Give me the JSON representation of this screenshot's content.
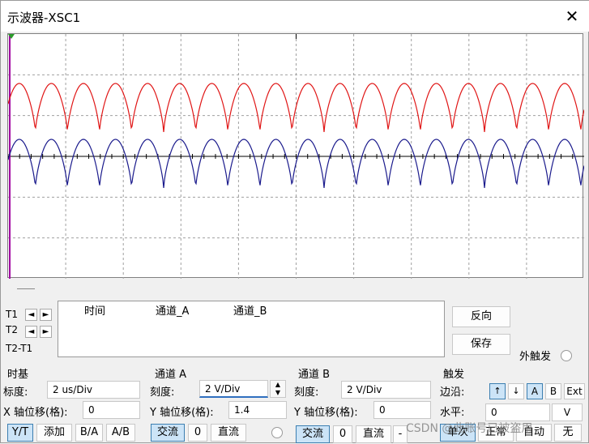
{
  "window": {
    "title": "示波器-XSC1",
    "close_glyph": "✕"
  },
  "colors": {
    "channel_a": "#e01515",
    "channel_b": "#1a1a8c",
    "trigger_marker": "#a000a0",
    "grid": "#a0a0a0"
  },
  "cursors": {
    "t1": "T1",
    "t2": "T2",
    "t2_t1": "T2-T1",
    "left_glyph": "◄",
    "right_glyph": "►"
  },
  "readout": {
    "headers": [
      "时间",
      "通道_A",
      "通道_B"
    ]
  },
  "buttons": {
    "reverse": "反向",
    "save": "保存"
  },
  "ext_trigger": {
    "label": "外触发"
  },
  "timebase": {
    "title": "时基",
    "scale_label": "标度:",
    "scale_value": "2 us/Div",
    "xpos_label": "X 轴位移(格):",
    "xpos_value": "0",
    "modes": [
      "Y/T",
      "添加",
      "B/A",
      "A/B"
    ],
    "active_mode": "Y/T"
  },
  "channel_a": {
    "title": "通道 A",
    "scale_label": "刻度:",
    "scale_value": "2  V/Div",
    "ypos_label": "Y 轴位移(格):",
    "ypos_value": "1.4",
    "coupling": [
      "交流",
      "0",
      "直流"
    ],
    "active_coupling": "交流"
  },
  "channel_b": {
    "title": "通道 B",
    "scale_label": "刻度:",
    "scale_value": "2  V/Div",
    "ypos_label": "Y 轴位移(格):",
    "ypos_value": "0",
    "coupling": [
      "交流",
      "0",
      "直流",
      "-"
    ],
    "active_coupling": "交流"
  },
  "trigger": {
    "title": "触发",
    "edge_label": "边沿:",
    "edge_rising": "↑",
    "edge_falling": "↓",
    "sources": [
      "A",
      "B",
      "Ext"
    ],
    "active_source": "A",
    "level_label": "水平:",
    "level_value": "0",
    "level_unit": "V",
    "modes": [
      "单次",
      "正常",
      "自动",
      "无"
    ],
    "active_mode": "单次"
  },
  "watermark": "CSDN @此账号已被盗用"
}
